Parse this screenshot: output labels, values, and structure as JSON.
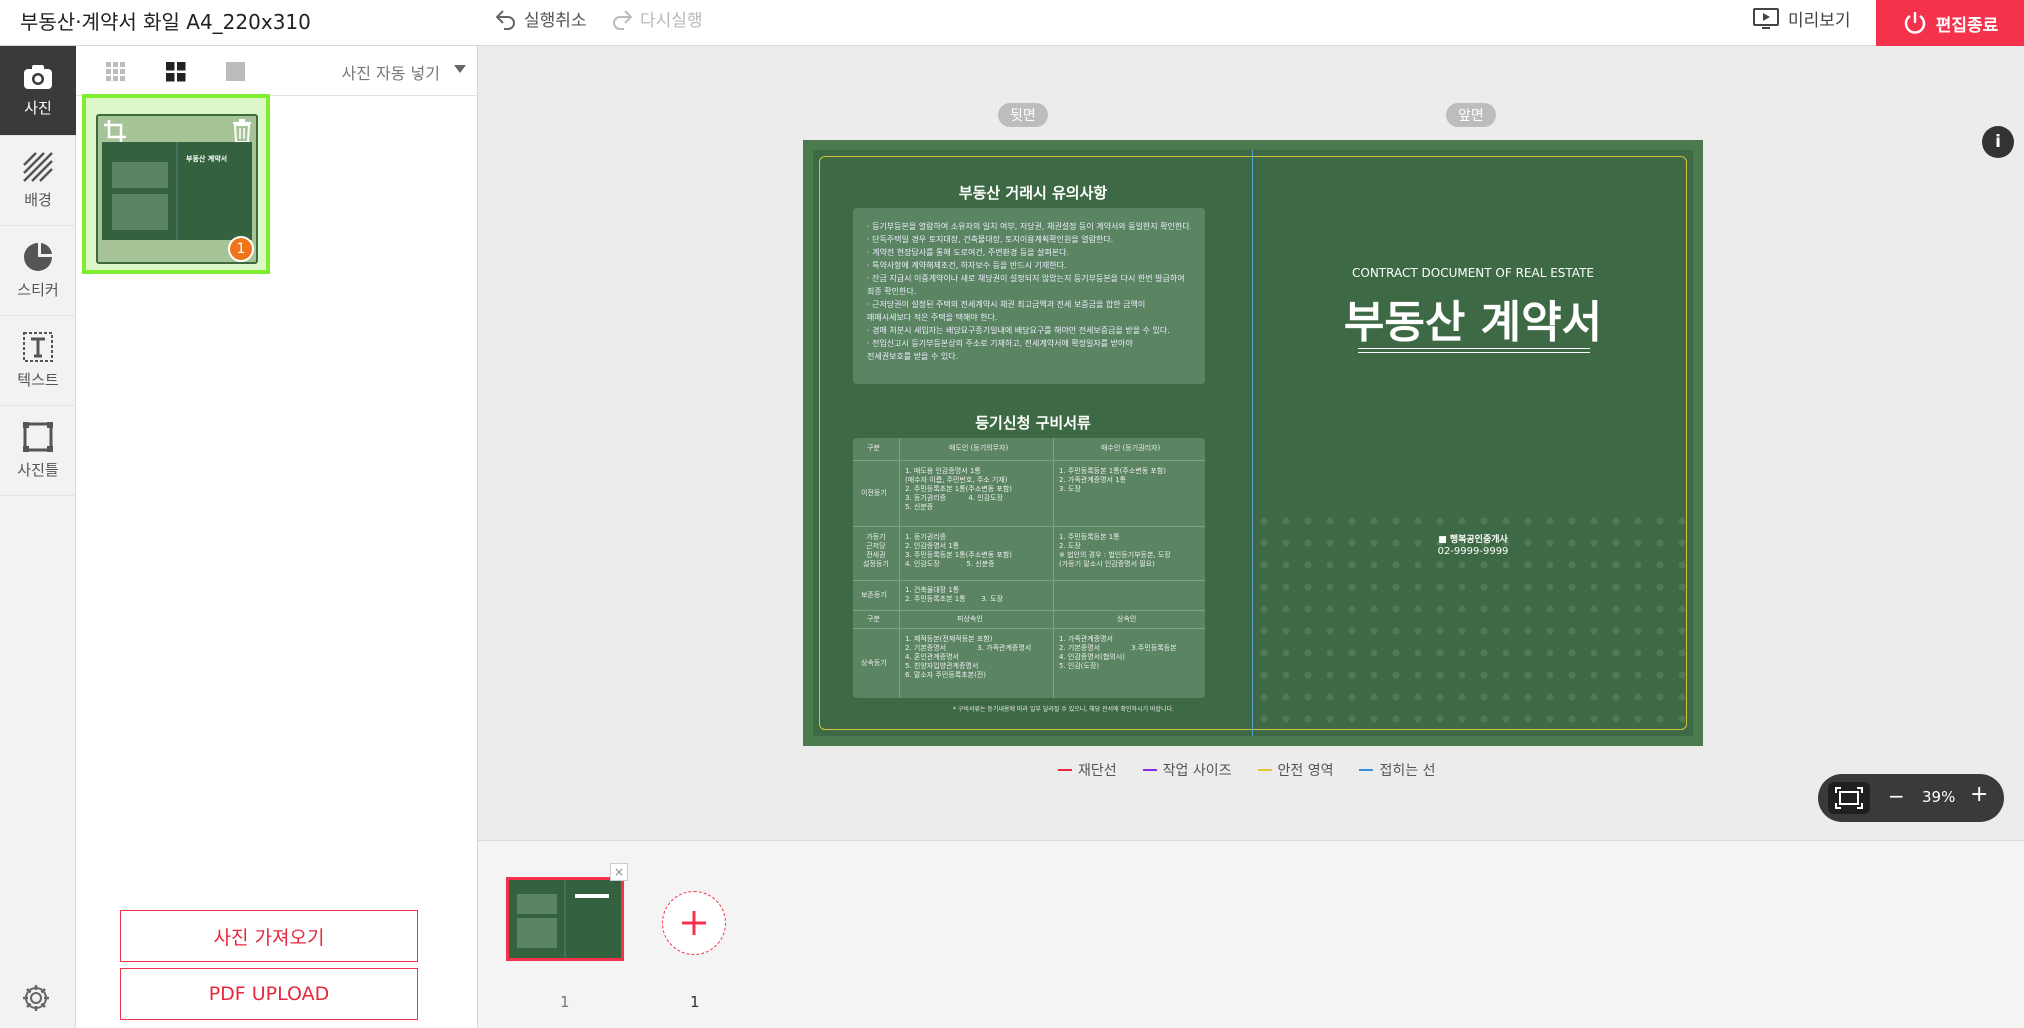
{
  "header": {
    "title": "부동산·계약서 화일 A4_220x310",
    "undo": "실행취소",
    "redo": "다시실행",
    "preview": "미리보기",
    "finish": "편집종료"
  },
  "tools": [
    {
      "label": "사진",
      "icon": "camera-icon"
    },
    {
      "label": "배경",
      "icon": "background-icon"
    },
    {
      "label": "스티커",
      "icon": "sticker-icon"
    },
    {
      "label": "텍스트",
      "icon": "text-icon"
    },
    {
      "label": "사진틀",
      "icon": "photo-frame-icon"
    }
  ],
  "photo_panel": {
    "auto_fill": "사진 자동 넣기",
    "thumbnail": {
      "title": "부동산 계약서",
      "usage_count": "1"
    },
    "import_button": "사진 가져오기",
    "pdf_button": "PDF UPLOAD"
  },
  "canvas": {
    "back_label": "뒷면",
    "front_label": "앞면",
    "back": {
      "title1": "부동산 거래시 유의사항",
      "notices": [
        "· 등기부등본을 열람하여 소유자의 일치 여부, 저당권, 채권설정 등이 계약서와 동일한지 확인한다.",
        "· 단독주택일 경우 토지대장, 건축물대장, 토지이용계획확인원을 열람한다.",
        "· 계약전 현장답사를 통해 도로여건, 주변환경 등을 살펴본다.",
        "· 특약사항에 계약해제조건, 하자보수 등을 반드시 기재한다.",
        "· 잔금 지급시 이중계약이나 새로 채당권이 설정되지 않았는지 등기부등본을 다시 한번 발급하여",
        "  최종 확인한다.",
        "· 근저당권이 설정된 주택의 전세계약시 채권 최고금액과 전세 보증금을 합한 금액이",
        "  매매시세보다 적은 주택을 택해야 한다.",
        "· 경매 처분시 세입자는 배당요구종기일내에 배당요구를 해야만 전세보증금을 받을 수 있다.",
        "· 전입신고시 등기부등본상의 주소로 기재하고, 전세계약서에 확정일자를 받아야",
        "  전세권보호를 받을 수 있다."
      ],
      "title2": "등기신청 구비서류",
      "table": {
        "headers": [
          "구분",
          "매도인 (등기의무자)",
          "매수인 (등기권리자)"
        ],
        "rows": [
          {
            "label": "이전등기",
            "a": "1. 매도용 인감증명서 1통\n(매수자 이름, 주민번호, 주소 기재)\n2. 주민등록초본 1통(주소변동 포함)\n3. 등기권리증          4. 인감도장\n5. 신분증",
            "b": "1. 주민등록등본 1통(주소변동 포함)\n2. 가족관계증명서 1통\n3. 도장"
          },
          {
            "label": "가등기\n근저당\n전세권\n설정등기",
            "a": "1. 등기권리증\n2. 인감증명서 1통\n3. 주민등록등본 1통(주소변동 포함)\n4. 인감도장            5. 신분증",
            "b": "1. 주민등록등본 1통\n2. 도장\n※ 법인의 경우 : 법인등기부등본, 도장\n(가등기 말소시 인감증명서 필요)"
          },
          {
            "label": "보존등기",
            "a": "1. 건축물대장 1통\n2. 주민등록초본 1통       3. 도장",
            "b": ""
          }
        ],
        "headers2": [
          "구분",
          "피상속인",
          "상속인"
        ],
        "inherit": {
          "label": "상속등기",
          "a": "1. 제적등본(전제적등본 포함)\n2. 기본증명서              3. 가족관계증명서\n4. 혼인관계증명서\n5. 친양자입양관계증명서\n6. 말소자 주민등록초본(전)",
          "b": "1. 가족관계증명서\n2. 기본증명서              3.주민등록등본\n4. 인감증명서(협의시)\n5. 인감(도장)"
        }
      },
      "footnote": "* 구비서류는 등기내용에 따라 일부 달라질 수 있으니, 해당 관서에 확인하시기 바랍니다."
    },
    "front": {
      "eng_title": "CONTRACT DOCUMENT OF REAL ESTATE",
      "kor_title": "부동산 계약서",
      "company": "■ 행복공인중개사",
      "phone": "02-9999-9999"
    }
  },
  "legend": [
    {
      "label": "재단선",
      "color": "#e8283e"
    },
    {
      "label": "작업 사이즈",
      "color": "#8a2be2"
    },
    {
      "label": "안전 영역",
      "color": "#e6c23a"
    },
    {
      "label": "접히는 선",
      "color": "#3a8fd8"
    }
  ],
  "zoom": {
    "value": "39%",
    "minus": "−",
    "plus": "+"
  },
  "pages": {
    "thumb_number": "1",
    "add_number": "1",
    "close": "×"
  },
  "colors": {
    "accent": "#f5324b",
    "panel_selected": "#80ee30",
    "canvas_green": "#3d6a44"
  }
}
